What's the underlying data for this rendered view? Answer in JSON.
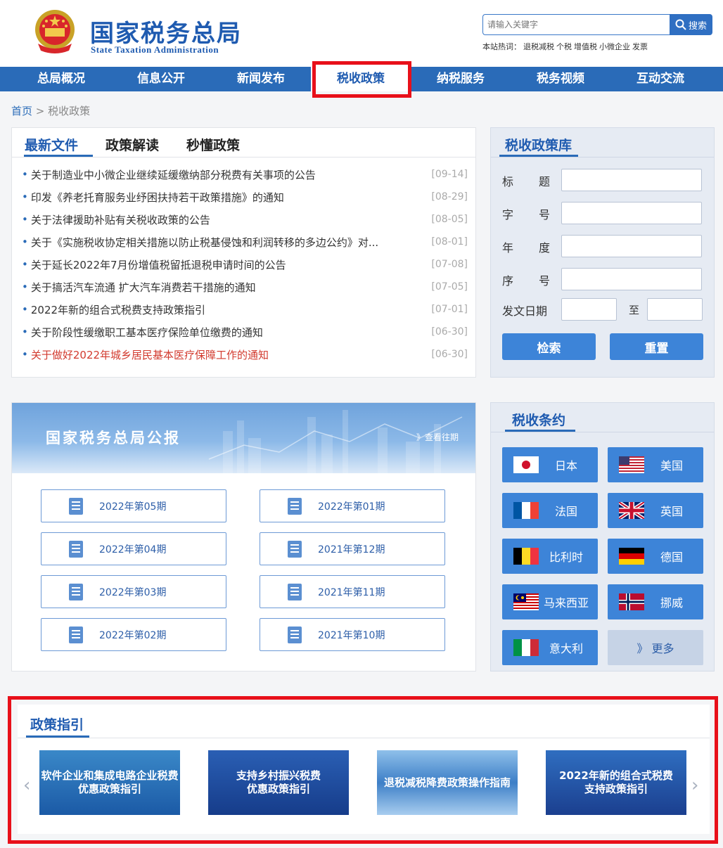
{
  "header": {
    "site_title_cn": "国家税务总局",
    "site_title_en": "State Taxation Administration",
    "search_placeholder": "请输入关键字",
    "search_button": "搜索",
    "hotwords_label": "本站热词：",
    "hotwords": [
      "退税减税",
      "个税",
      "增值税",
      "小微企业",
      "发票"
    ]
  },
  "nav": [
    "总局概况",
    "信息公开",
    "新闻发布",
    "税收政策",
    "纳税服务",
    "税务视频",
    "互动交流"
  ],
  "nav_active": "税收政策",
  "breadcrumb": {
    "home": "首页",
    "sep": ">",
    "current": "税收政策"
  },
  "latest": {
    "tabs": [
      "最新文件",
      "政策解读",
      "秒懂政策"
    ],
    "items": [
      {
        "title": "关于制造业中小微企业继续延缓缴纳部分税费有关事项的公告",
        "date": "[09-14]"
      },
      {
        "title": "印发《养老托育服务业纾困扶持若干政策措施》的通知",
        "date": "[08-29]"
      },
      {
        "title": "关于法律援助补贴有关税收政策的公告",
        "date": "[08-05]"
      },
      {
        "title": "关于《实施税收协定相关措施以防止税基侵蚀和利润转移的多边公约》对...",
        "date": "[08-01]"
      },
      {
        "title": "关于延长2022年7月份增值税留抵退税申请时间的公告",
        "date": "[07-08]"
      },
      {
        "title": "关于搞活汽车流通 扩大汽车消费若干措施的通知",
        "date": "[07-05]"
      },
      {
        "title": "2022年新的组合式税费支持政策指引",
        "date": "[07-01]"
      },
      {
        "title": "关于阶段性缓缴职工基本医疗保险单位缴费的通知",
        "date": "[06-30]"
      },
      {
        "title": "关于做好2022年城乡居民基本医疗保障工作的通知",
        "date": "[06-30]",
        "highlight": true
      }
    ]
  },
  "library": {
    "title": "税收政策库",
    "fields": [
      [
        "标",
        "题"
      ],
      [
        "字",
        "号"
      ],
      [
        "年",
        "度"
      ],
      [
        "序",
        "号"
      ]
    ],
    "date_label": "发文日期",
    "date_to": "至",
    "search_btn": "检索",
    "reset_btn": "重置"
  },
  "bulletin": {
    "title": "国家税务总局公报",
    "more": "》查看往期",
    "issues": [
      "2022年第05期",
      "2022年第01期",
      "2022年第04期",
      "2021年第12期",
      "2022年第03期",
      "2021年第11期",
      "2022年第02期",
      "2021年第10期"
    ]
  },
  "treaties": {
    "title": "税收条约",
    "countries": [
      "日本",
      "美国",
      "法国",
      "英国",
      "比利时",
      "德国",
      "马来西亚",
      "挪威",
      "意大利"
    ],
    "more": "》 更多"
  },
  "guide": {
    "title": "政策指引",
    "cards": [
      {
        "line1": "软件企业和集成电路企业税费",
        "line2": "优惠政策指引"
      },
      {
        "line1": "支持乡村振兴税费",
        "line2": "优惠政策指引"
      },
      {
        "line1": "退税减税降费政策操作指南",
        "line2": ""
      },
      {
        "line1": "2022年新的组合式税费",
        "line2": "支持政策指引"
      }
    ]
  },
  "colors": {
    "brand": "#1f5bb0",
    "nav": "#2a6bb8",
    "button": "#3d84d8",
    "highlight_text": "#d23a2e",
    "annotation_red": "#e8101a"
  }
}
